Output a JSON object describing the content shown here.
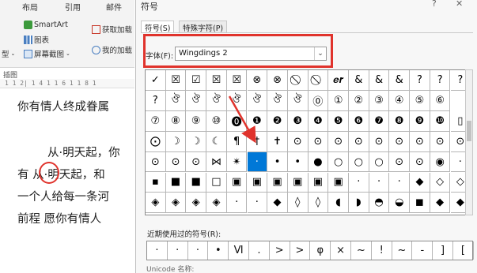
{
  "word": {
    "ribbon_tabs": [
      "布局",
      "引用",
      "邮件"
    ],
    "ribbon": {
      "smartart": "SmartArt",
      "chart": "图表",
      "screenshot": "屏幕截图",
      "get_addins": "获取加载",
      "my_addins": "我的加载",
      "left_stub": "型",
      "group_label": "插图"
    },
    "ruler_text": "1  1 2|  1 4 1  1 6 1  1 8 1",
    "doc_lines": [
      "你有情人终成眷属",
      "从·明天起，你",
      "有 从·明天起，和",
      "一个人给每一条河",
      "前程  愿你有情人"
    ]
  },
  "dialog": {
    "title": "符号",
    "help": "?",
    "close": "✕",
    "tabs": [
      "符号(S)",
      "特殊字符(P)"
    ],
    "font_label": "字体(F):",
    "font_value": "Wingdings 2",
    "recent_label": "近期使用过的符号(R):",
    "bottom_label": "Unicode 名称:",
    "colors": {
      "highlight": "#e0332c",
      "selection": "#0078d7"
    },
    "grid": [
      [
        "✓",
        "☒",
        "☑",
        "☒",
        "☒",
        "⊗",
        "⊗",
        "⃠",
        "⃠",
        "𝒆𝒓",
        "&",
        "&",
        "&",
        "?",
        "?",
        "?"
      ],
      [
        "?",
        "ঔ",
        "ঔ",
        "ঔ",
        "ঔ",
        "ঔ",
        "ঔ",
        "ঔ",
        "⓪",
        "①",
        "②",
        "③",
        "④",
        "⑤",
        "⑥"
      ],
      [
        "⑦",
        "⑧",
        "⑨",
        "⑩",
        "⓿",
        "❶",
        "❷",
        "❸",
        "❹",
        "❺",
        "❻",
        "❼",
        "❽",
        "❾",
        "❿",
        "▯"
      ],
      [
        "⨀",
        "☽",
        "☽",
        "☾",
        "¶",
        "†",
        "✝",
        "⊙",
        "⊙",
        "⊙",
        "⊙",
        "⊙",
        "⊙",
        "⊙",
        "⊙",
        "⊙"
      ],
      [
        "⊙",
        "⊙",
        "⊙",
        "⋈",
        "✴",
        "·",
        "•",
        "•",
        "●",
        "○",
        "○",
        "○",
        "⊙",
        "⊙",
        "◉",
        "·"
      ],
      [
        "▪",
        "■",
        "■",
        "□",
        "▣",
        "▣",
        "▣",
        "▣",
        "▣",
        "▣",
        "·",
        "·",
        "·",
        "◆",
        "◇",
        "◇"
      ],
      [
        "◈",
        "◈",
        "◈",
        "◈",
        "·",
        "·",
        "◆",
        "◊",
        "◊",
        "◖",
        "◗",
        "◓",
        "◒",
        "◼",
        "◆",
        "◆"
      ]
    ],
    "recent": [
      "·",
      "·",
      "·",
      "•",
      "Ⅵ",
      ".",
      ">",
      ">",
      "φ",
      "×",
      "~",
      "!",
      "~",
      "-",
      "]",
      "["
    ]
  }
}
